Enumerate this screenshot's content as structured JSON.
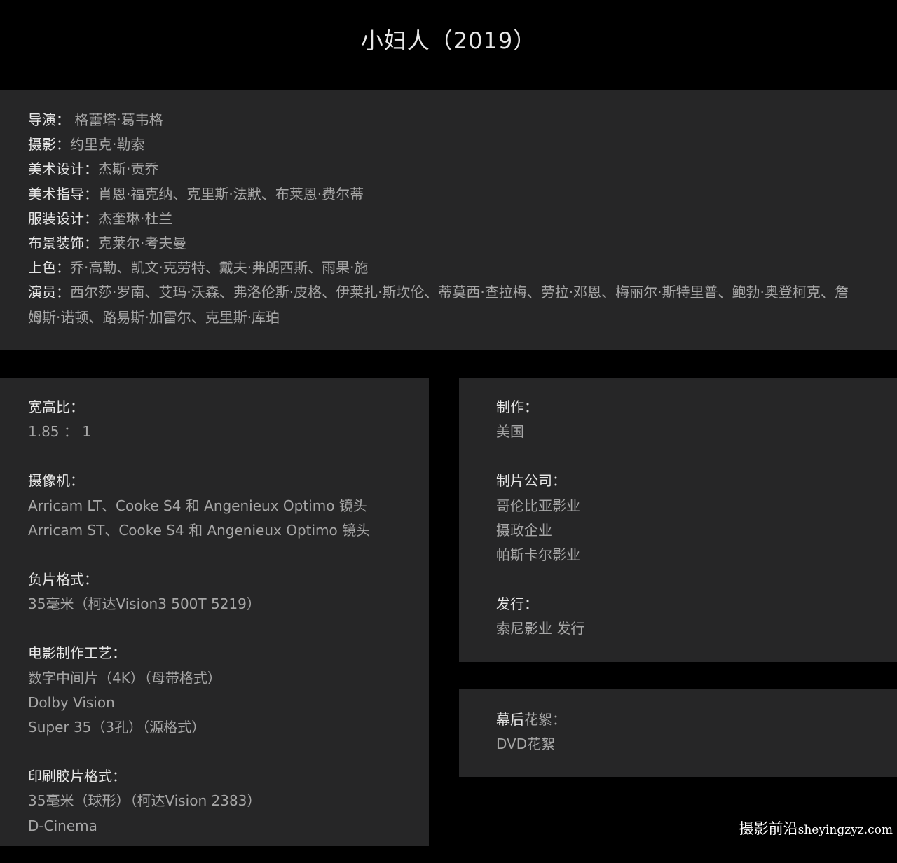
{
  "title": "小妇人（2019）",
  "credits": {
    "director": {
      "label": "导演：",
      "value": " 格蕾塔·葛韦格"
    },
    "cinematography": {
      "label": "摄影：",
      "value": "约里克·勒索"
    },
    "production_design": {
      "label": "美术设计：",
      "value": "杰斯·贡乔"
    },
    "art_direction": {
      "label": "美术指导：",
      "value": "肖恩·福克纳、克里斯·法默、布莱恩·费尔蒂"
    },
    "costume_design": {
      "label": "服装设计：",
      "value": "杰奎琳·杜兰"
    },
    "set_decoration": {
      "label": "布景装饰：",
      "value": "克莱尔·考夫曼"
    },
    "colorist": {
      "label": "上色：",
      "value": "乔·高勒、凯文·克劳特、戴夫·弗朗西斯、雨果·施"
    },
    "cast": {
      "label": "演员：",
      "value": "西尔莎·罗南、艾玛·沃森、弗洛伦斯·皮格、伊莱扎·斯坎伦、蒂莫西·查拉梅、劳拉·邓恩、梅丽尔·斯特里普、鲍勃·奥登柯克、詹姆斯·诺顿、路易斯·加雷尔、克里斯·库珀"
    }
  },
  "specs_left": {
    "aspect_ratio": {
      "title": "宽高比：",
      "items": [
        "1.85 ： 1"
      ]
    },
    "camera": {
      "title": "摄像机：",
      "items": [
        "Arricam LT、Cooke S4 和 Angenieux Optimo 镜头",
        "Arricam ST、Cooke S4 和 Angenieux Optimo 镜头"
      ]
    },
    "negative_format": {
      "title": "负片格式：",
      "items": [
        "35毫米（柯达Vision3 500T 5219）"
      ]
    },
    "cinematographic_process": {
      "title": "电影制作工艺：",
      "items": [
        "数字中间片（4K）（母带格式）",
        "Dolby Vision",
        "Super 35（3孔）（源格式）"
      ]
    },
    "printed_film_format": {
      "title": "印刷胶片格式：",
      "items": [
        "35毫米（球形）（柯达Vision 2383）",
        "D-Cinema"
      ]
    }
  },
  "specs_right": {
    "production": {
      "title": "制作：",
      "items": [
        "美国"
      ]
    },
    "production_companies": {
      "title": "制片公司：",
      "items": [
        "哥伦比亚影业",
        "摄政企业",
        "帕斯卡尔影业"
      ]
    },
    "distribution": {
      "title": "发行：",
      "items": [
        "索尼影业 发行"
      ]
    }
  },
  "behind_the_scenes": {
    "title_strong": "幕后",
    "title_rest": "花絮：",
    "items": [
      "DVD花絮"
    ]
  },
  "watermark": {
    "cn": "摄影前沿",
    "latin": "sheyingzyz.com"
  },
  "colors": {
    "background": "#000000",
    "panel": "#262627",
    "label": "#e6e6e6",
    "value": "#a7a7a7",
    "title": "#e8e8e8"
  }
}
